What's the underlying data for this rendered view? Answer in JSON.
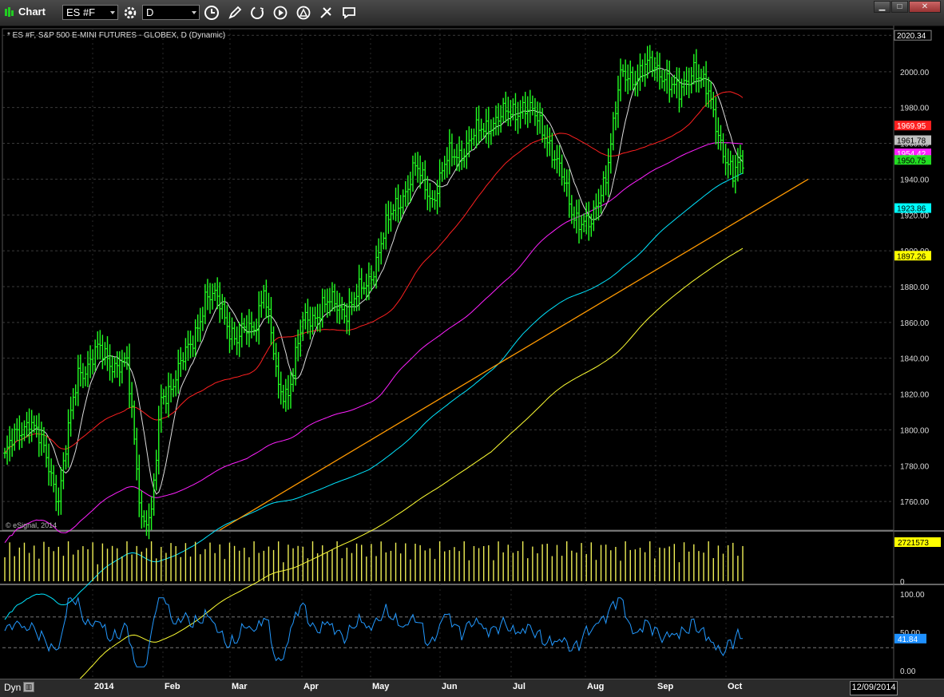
{
  "app": {
    "title": "Chart"
  },
  "toolbar": {
    "symbol": "ES #F",
    "interval": "D"
  },
  "chart_data": {
    "type": "bar",
    "title": "* ES #F, S&P 500 E-MINI FUTURES - GLOBEX, D (Dynamic)",
    "watermark": "© eSignal, 2014",
    "xlabel": "",
    "ylabel": "",
    "x_ticks": [
      "2014",
      "Feb",
      "Mar",
      "Apr",
      "May",
      "Jun",
      "Jul",
      "Aug",
      "Sep",
      "Oct"
    ],
    "y_ticks": [
      "2020.34",
      "2000.00",
      "1980.00",
      "1960.00",
      "1940.00",
      "1920.00",
      "1900.00",
      "1880.00",
      "1860.00",
      "1840.00",
      "1820.00",
      "1800.00",
      "1780.00",
      "1760.00"
    ],
    "ylim": [
      1744,
      2024
    ],
    "price_tags": [
      {
        "label": "2020.34",
        "value": 2020.34,
        "bg": "#000000",
        "fg": "#ffffff"
      },
      {
        "label": "1969.95",
        "value": 1969.95,
        "bg": "#ff2020",
        "fg": "#ffffff"
      },
      {
        "label": "1961.78",
        "value": 1961.78,
        "bg": "#c0c0c0",
        "fg": "#000000"
      },
      {
        "label": "1954.42",
        "value": 1954.42,
        "bg": "#ff20ff",
        "fg": "#ffffff"
      },
      {
        "label": "1950.75",
        "value": 1950.75,
        "bg": "#22dd22",
        "fg": "#000000"
      },
      {
        "label": "1923.86",
        "value": 1923.86,
        "bg": "#00ffff",
        "fg": "#000000"
      },
      {
        "label": "1897.26",
        "value": 1897.26,
        "bg": "#ffff00",
        "fg": "#000000"
      }
    ],
    "series": [
      {
        "name": "",
        "color": "#22ff22",
        "type": "ohlc"
      },
      {
        "name": "",
        "color": "#dddddd",
        "type": "ma"
      },
      {
        "name": "",
        "color": "#ff2020",
        "type": "ma"
      },
      {
        "name": "",
        "color": "#ff20ff",
        "type": "ma"
      },
      {
        "name": "",
        "color": "#00e5ff",
        "type": "ma"
      },
      {
        "name": "",
        "color": "#ffff33",
        "type": "ma"
      },
      {
        "name": "",
        "color": "#ff9900",
        "type": "trendline"
      }
    ],
    "volume": {
      "y_ticks": [
        "2721573",
        "0"
      ],
      "last": "2721573",
      "color": "#eeee55"
    },
    "oscillator": {
      "y_ticks": [
        "100.00",
        "50.00",
        "0.00"
      ],
      "levels": [
        70,
        30
      ],
      "last": "41.84",
      "color": "#2299ff",
      "ylim": [
        0,
        100
      ]
    }
  },
  "bottom": {
    "dyn_label": "Dyn",
    "date": "12/09/2014"
  }
}
